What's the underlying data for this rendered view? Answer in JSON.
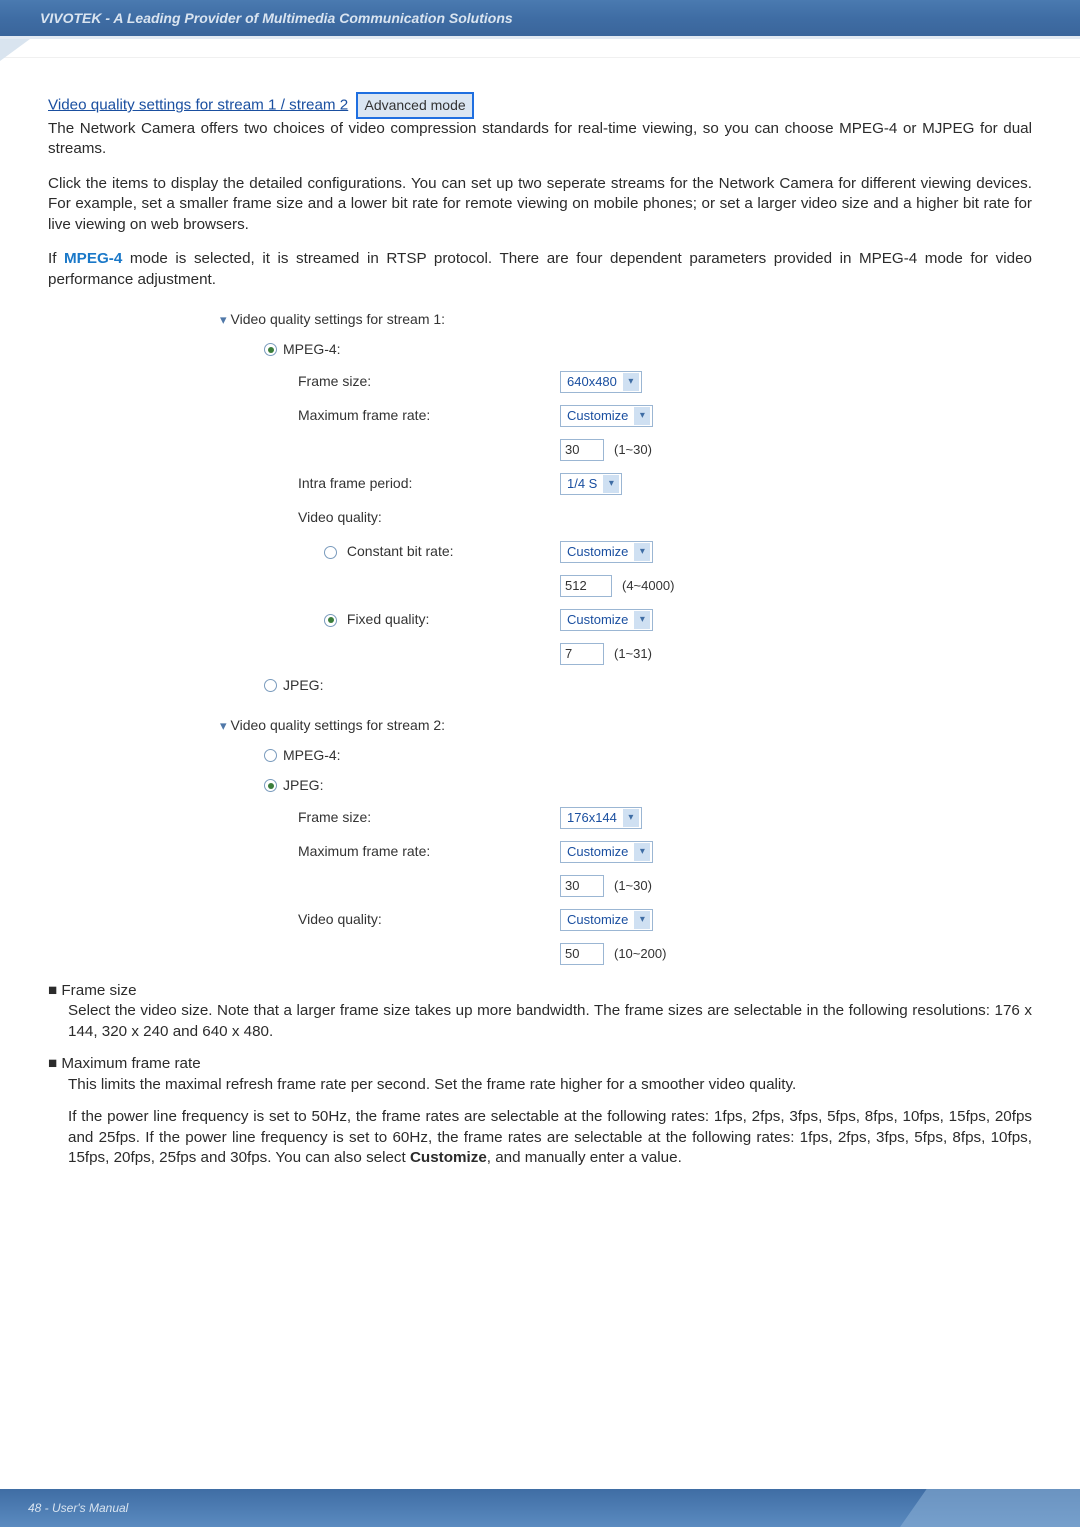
{
  "header": {
    "brand_tagline": "VIVOTEK - A Leading Provider of Multimedia Communication Solutions"
  },
  "intro": {
    "section_link": "Video quality settings for stream 1 / stream 2",
    "badge": "Advanced mode",
    "p1": "The Network Camera offers two choices of video compression standards for real-time viewing, so you can choose MPEG-4 or MJPEG for dual streams.",
    "p2": "Click the items to display the detailed configurations. You can set up two seperate streams for the Network Camera for different viewing devices. For example, set a smaller frame size and a lower bit rate for remote viewing on mobile phones; or set a larger video size and a higher bit rate for live viewing on web browsers.",
    "p3_pre": "If ",
    "p3_mpeg4": "MPEG-4",
    "p3_post": " mode is selected, it is streamed in RTSP protocol. There are four dependent parameters provided  in MPEG-4 mode for video performance adjustment."
  },
  "stream1": {
    "title": "Video quality settings for stream 1:",
    "mpeg4_label": "MPEG-4:",
    "frame_size_label": "Frame size:",
    "frame_size_value": "640x480",
    "max_frame_rate_label": "Maximum frame rate:",
    "max_frame_rate_value": "Customize",
    "max_frame_rate_custom": "30",
    "max_frame_rate_hint": "(1~30)",
    "intra_label": "Intra frame period:",
    "intra_value": "1/4 S",
    "video_quality_label": "Video quality:",
    "cbr_label": "Constant bit rate:",
    "cbr_value": "Customize",
    "cbr_custom": "512",
    "cbr_hint": "(4~4000)",
    "fq_label": "Fixed quality:",
    "fq_value": "Customize",
    "fq_custom": "7",
    "fq_hint": "(1~31)",
    "jpeg_label": "JPEG:"
  },
  "stream2": {
    "title": "Video quality settings for stream 2:",
    "mpeg4_label": "MPEG-4:",
    "jpeg_label": "JPEG:",
    "frame_size_label": "Frame size:",
    "frame_size_value": "176x144",
    "max_frame_rate_label": "Maximum frame rate:",
    "max_frame_rate_value": "Customize",
    "max_frame_rate_custom": "30",
    "max_frame_rate_hint": "(1~30)",
    "video_quality_label": "Video quality:",
    "vq_value": "Customize",
    "vq_custom": "50",
    "vq_hint": "(10~200)"
  },
  "bullets": {
    "b1_title": "Frame size",
    "b1_body": "Select the video size. Note that a larger frame size takes up more bandwidth. The frame sizes are selectable in the following resolutions: 176 x 144, 320 x 240 and 640 x 480.",
    "b2_title": "Maximum frame rate",
    "b2_body": "This limits the maximal refresh frame rate per second. Set the frame rate higher for a smoother video quality.",
    "b3_body_pre": "If the power line frequency is set to 50Hz, the frame rates are selectable at the following rates: 1fps, 2fps, 3fps, 5fps, 8fps, 10fps, 15fps, 20fps and 25fps. If the power line frequency is set to 60Hz, the frame rates are selectable at the following rates: 1fps, 2fps, 3fps, 5fps, 8fps, 10fps, 15fps, 20fps, 25fps and 30fps. You can also select ",
    "b3_bold": "Customize",
    "b3_body_post": ", and manually enter a value."
  },
  "footer": {
    "page": "48 - User's Manual"
  }
}
